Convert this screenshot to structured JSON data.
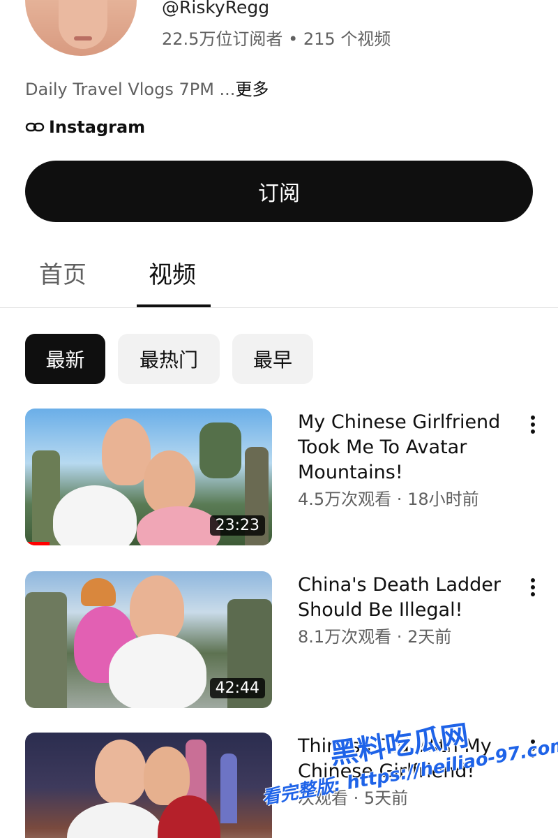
{
  "channel": {
    "handle": "@RiskyRegg",
    "subscribers": "22.5万位订阅者",
    "separator": "•",
    "video_count": "215 个视频",
    "bio": "Daily Travel Vlogs 7PM ...",
    "bio_more": "更多",
    "link_label": "Instagram",
    "subscribe_label": "订阅"
  },
  "tabs": [
    {
      "label": "首页",
      "active": false
    },
    {
      "label": "视频",
      "active": true
    }
  ],
  "filters": [
    {
      "label": "最新",
      "active": true
    },
    {
      "label": "最热门",
      "active": false
    },
    {
      "label": "最早",
      "active": false
    }
  ],
  "videos": [
    {
      "title": "My Chinese Girlfriend Took Me To Avatar Mountains!",
      "views": "4.5万次观看",
      "age": "18小时前",
      "duration": "23:23",
      "watched_fraction": 0.1
    },
    {
      "title": "China's Death Ladder Should Be Illegal!",
      "views": "8.1万次观看",
      "age": "2天前",
      "duration": "42:44"
    },
    {
      "title": "Things I Did With My Chinese Girlfriend!",
      "views": "次观看",
      "age": "5天前",
      "duration": ""
    }
  ],
  "watermark": {
    "brand": "黑料吃瓜网",
    "url_text": "看完整版: https://heiliao-97.com"
  },
  "colors": {
    "accent": "#0f0f0f",
    "progress": "#ff0000",
    "watermark": "#1e63e8"
  }
}
